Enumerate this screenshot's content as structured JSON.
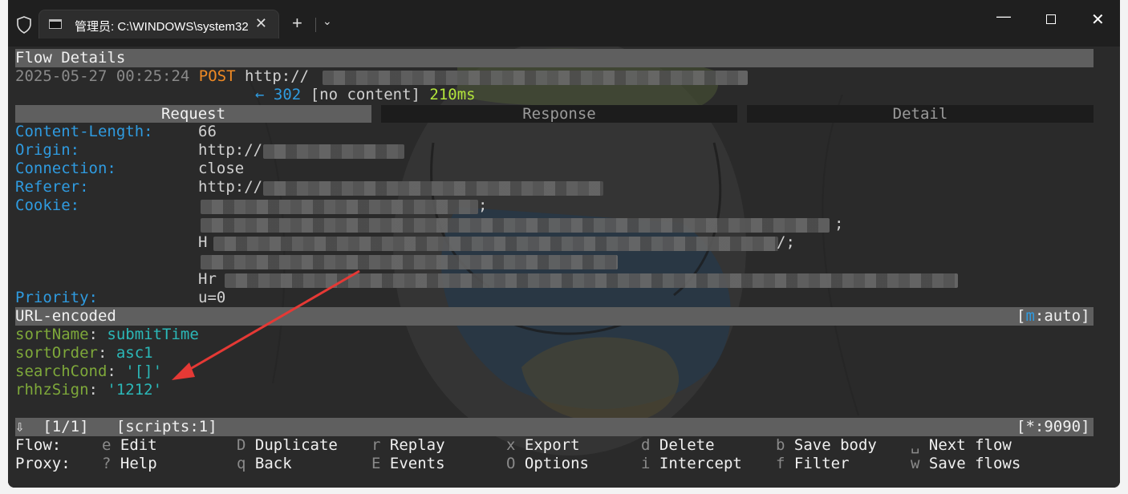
{
  "window": {
    "tab_title": "管理员: C:\\WINDOWS\\system32",
    "tab_close": "✕",
    "new_tab": "+",
    "dropdown": "⌄",
    "minimize": "—",
    "close": "✕"
  },
  "flow": {
    "heading": "Flow Details",
    "timestamp": "2025-05-27 00:25:24",
    "method": "POST",
    "url_prefix": "http://",
    "arrow": "←",
    "status_code": "302",
    "content": "[no content]",
    "duration": "210ms"
  },
  "tabs": [
    "Request",
    "Response",
    "Detail"
  ],
  "headers": [
    {
      "key": "Content-Length:",
      "value": "66"
    },
    {
      "key": "Origin:",
      "value": "http://"
    },
    {
      "key": "Connection:",
      "value": "close"
    },
    {
      "key": "Referer:",
      "value": "http://"
    },
    {
      "key": "Cookie:",
      "value": ""
    },
    {
      "key": "Priority:",
      "value": "u=0"
    }
  ],
  "cookie_fragments": [
    ";",
    ";",
    "H",
    "/;",
    "Hr"
  ],
  "form": {
    "heading": "URL-encoded",
    "mode_open": "[",
    "mode_key": "m",
    "mode_rest": ":auto]",
    "fields": [
      {
        "name": "sortName",
        "value": "submitTime"
      },
      {
        "name": "sortOrder",
        "value": "asc1"
      },
      {
        "name": "searchCond",
        "value": "'[]'"
      },
      {
        "name": "rhhzSign",
        "value": "'1212'"
      }
    ]
  },
  "statusbar": {
    "left": "⇩  [1/1]   [scripts:1]",
    "right": "[*:9090]"
  },
  "shortcuts": {
    "flow_label": "Flow:",
    "proxy_label": "Proxy:",
    "flow_row": [
      {
        "key": "e",
        "label": "Edit"
      },
      {
        "key": "D",
        "label": "Duplicate"
      },
      {
        "key": "r",
        "label": "Replay"
      },
      {
        "key": "x",
        "label": "Export"
      },
      {
        "key": "d",
        "label": "Delete"
      },
      {
        "key": "b",
        "label": "Save body"
      },
      {
        "key": "␣",
        "label": "Next flow"
      }
    ],
    "proxy_row": [
      {
        "key": "?",
        "label": "Help"
      },
      {
        "key": "q",
        "label": "Back"
      },
      {
        "key": "E",
        "label": "Events"
      },
      {
        "key": "O",
        "label": "Options"
      },
      {
        "key": "i",
        "label": "Intercept"
      },
      {
        "key": "f",
        "label": "Filter"
      },
      {
        "key": "w",
        "label": "Save flows"
      }
    ]
  },
  "colors": {
    "header_key": "#2f9be0",
    "method": "#f08a24",
    "duration": "#b3e63b",
    "param_name": "#7ea83a",
    "param_value": "#2bb8b8",
    "annotation_arrow": "#e53935"
  }
}
